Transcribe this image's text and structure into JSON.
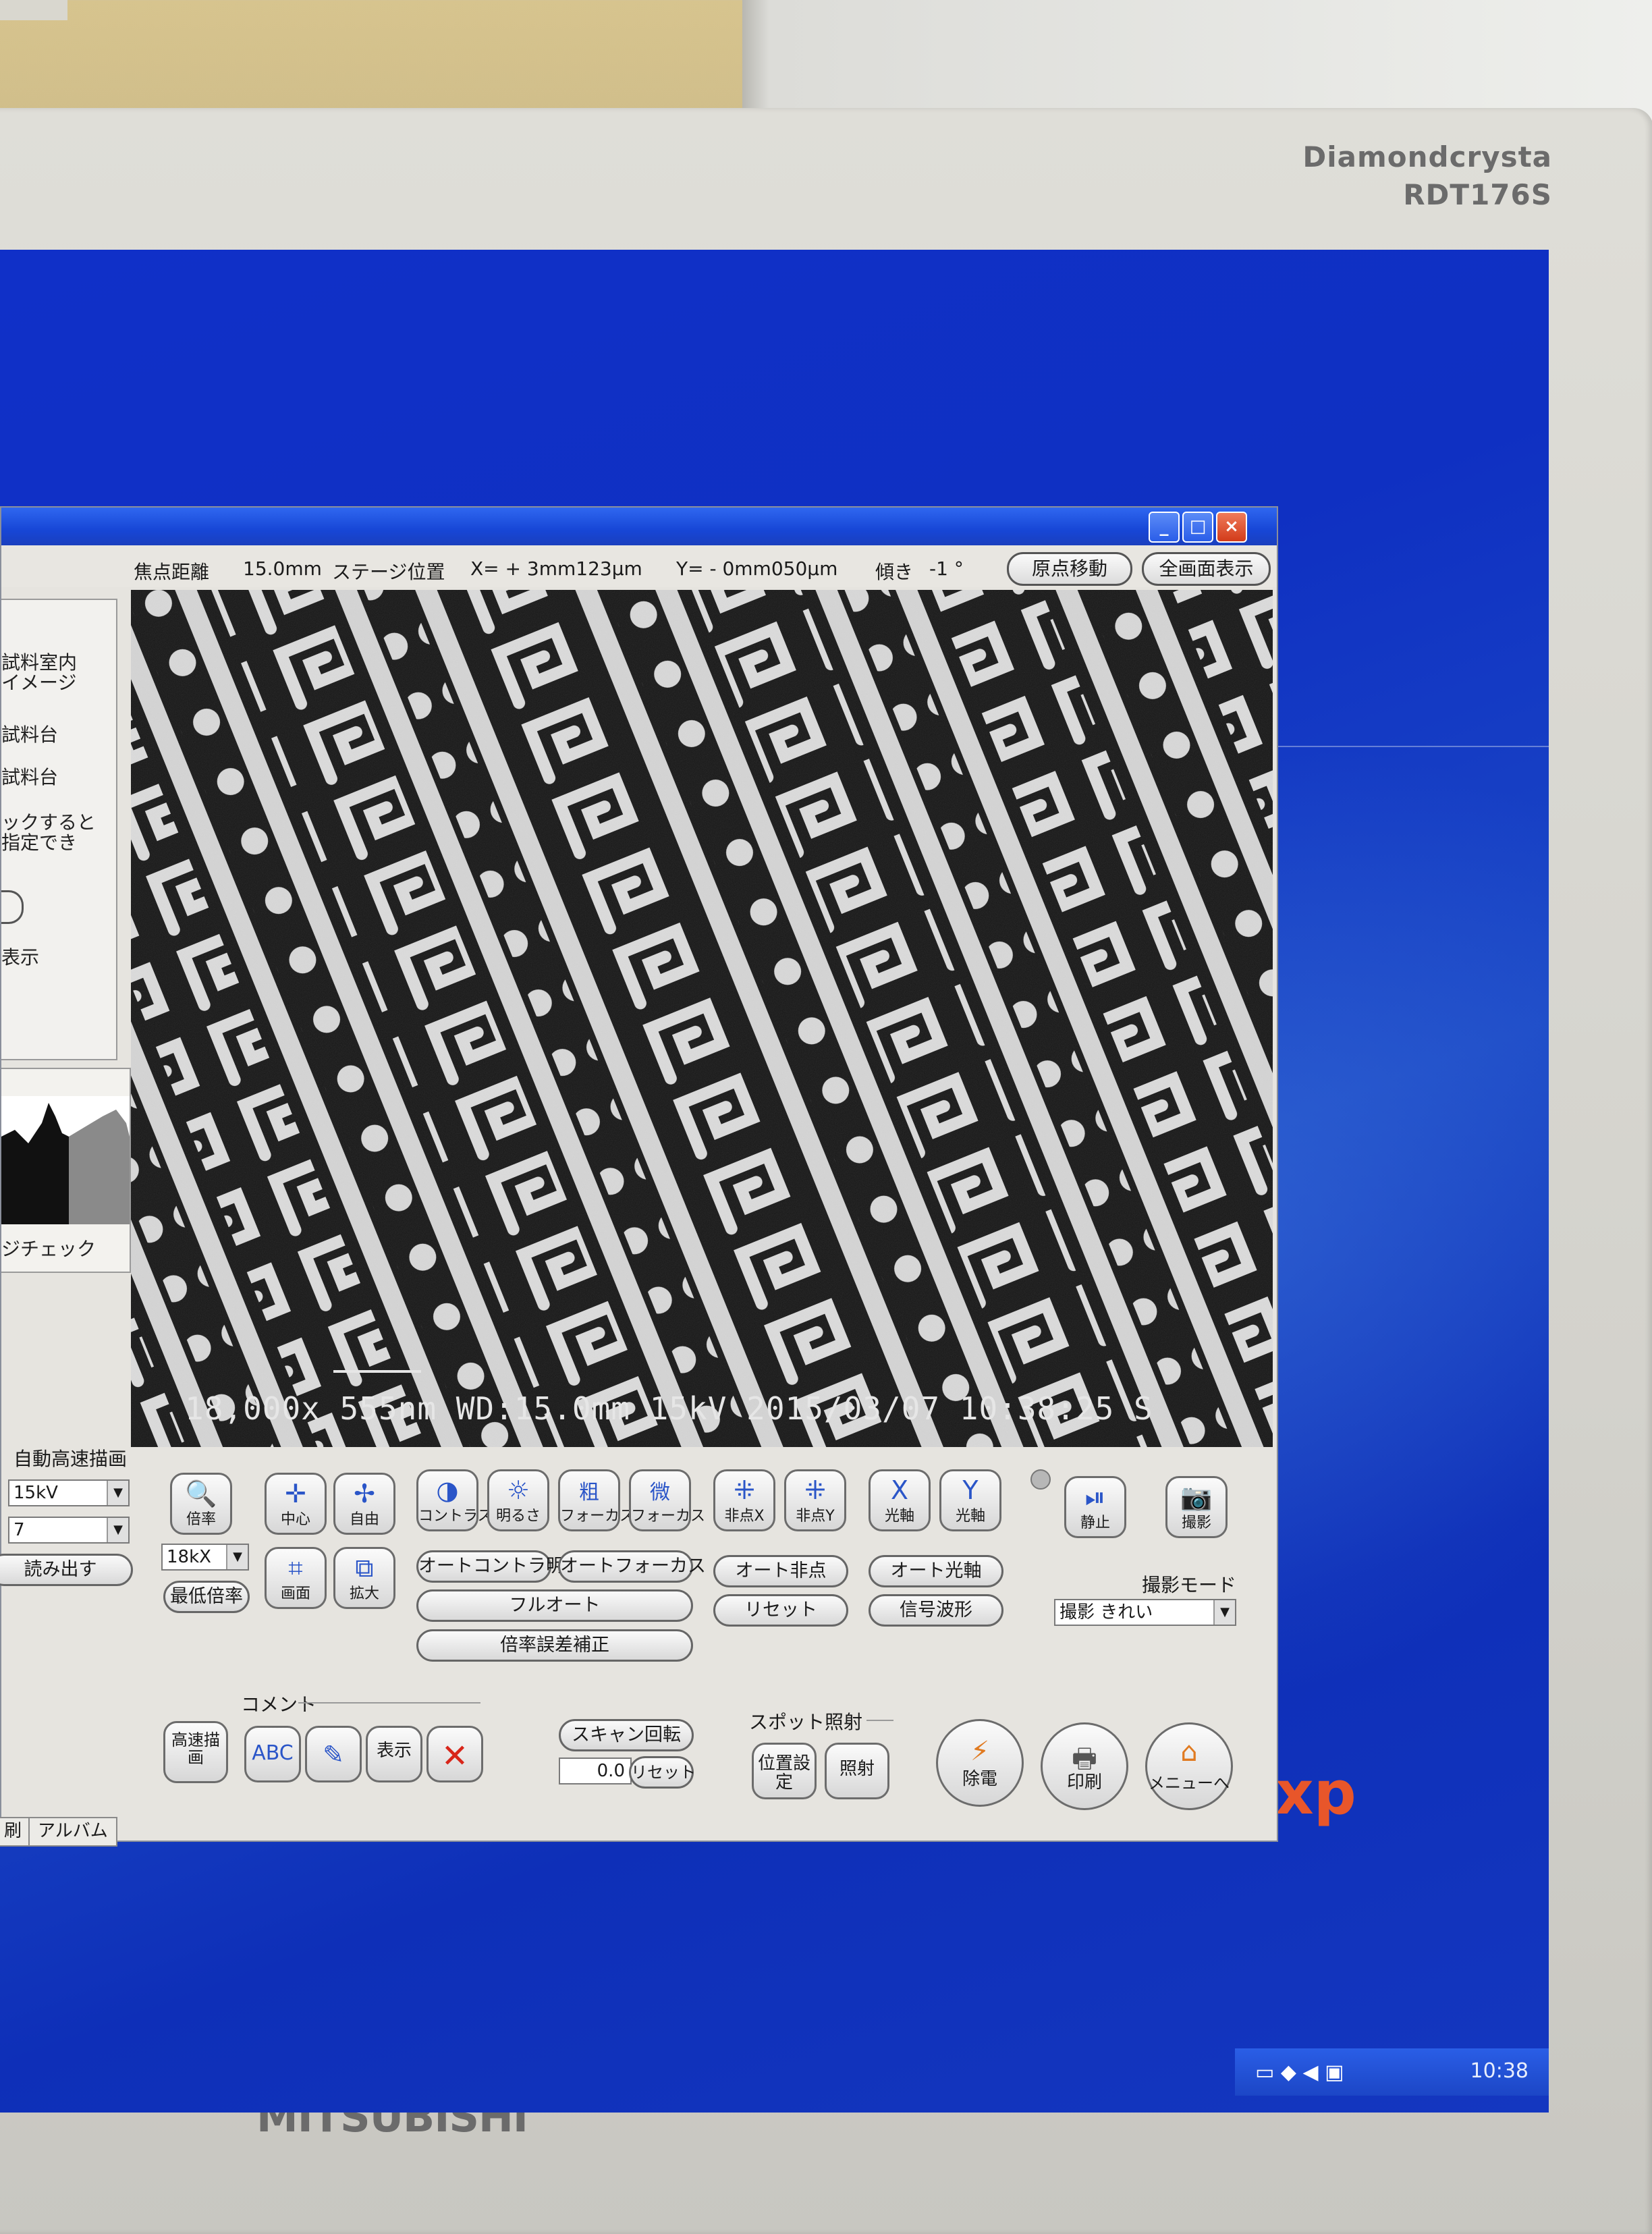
{
  "monitor": {
    "brand_top_line1": "Diamondcrysta",
    "brand_top_line2": "RDT176S",
    "brand_bottom": "MITSUBISHI"
  },
  "desktop": {
    "xp_logo": "xp",
    "clock": "10:38"
  },
  "window": {
    "minimize": "_",
    "maximize": "□",
    "close": "×"
  },
  "infobar": {
    "focus_label": "焦点距離",
    "focus_value": "15.0mm",
    "stage_label": "ステージ位置",
    "x_value": "X= +  3mm123μm",
    "y_value": "Y= -  0mm050μm",
    "tilt_label": "傾き",
    "tilt_value": "-1 °",
    "origin_button": "原点移動",
    "fullscreen_button": "全画面表示"
  },
  "left_panel": {
    "line1": "試料室内",
    "line2": "イメージ",
    "line3": "試料台",
    "line4": "試料台",
    "line5": "ックすると",
    "line6": "指定でき",
    "line7": "表示",
    "histogram_label": "ジチェック",
    "auto_draw": "自動高速描画",
    "kv_select": "15kV",
    "num_select": "7",
    "load_button": "読み出す",
    "tab1": "刷",
    "tab2": "アルバム"
  },
  "sem_image": {
    "overlay_text": "18,000x  555nm WD:15.0mm  15kV 2015/03/07 10:38:25 S"
  },
  "controls": {
    "magnify": "倍率",
    "center": "中心",
    "free": "自由",
    "contrast": "コントラスト",
    "brightness": "明るさ",
    "coarse_focus_icon": "粗",
    "coarse_focus": "フォーカス",
    "fine_focus_icon": "微",
    "fine_focus": "フォーカス",
    "stig_x": "非点X",
    "stig_y": "非点Y",
    "axis_x_icon": "X",
    "axis_x": "光軸",
    "axis_y_icon": "Y",
    "axis_y": "光軸",
    "freeze": "静止",
    "capture": "撮影",
    "mag_select": "18kX",
    "screen": "画面",
    "enlarge": "拡大",
    "min_mag": "最低倍率",
    "auto_contrast": "オートコントラ明るさ",
    "auto_focus": "オートフォーカス",
    "auto_stig": "オート非点",
    "auto_axis": "オート光軸",
    "full_auto": "フルオート",
    "reset": "リセット",
    "signal_wave": "信号波形",
    "mag_error_correction": "倍率誤差補正",
    "capture_mode_label": "撮影モード",
    "capture_mode_value": "撮影  きれい",
    "comment_label": "コメント",
    "high_speed_draw": "高速描画",
    "abc_icon": "ABC",
    "display": "表示",
    "scan_rotate": "スキャン回転",
    "rotate_value": "0.0",
    "rotate_reset": "リセット",
    "spot_label": "スポット照射",
    "position_set": "位置設定",
    "irradiate": "照射",
    "discharge": "除電",
    "print": "印刷",
    "menu": "メニューへ"
  }
}
